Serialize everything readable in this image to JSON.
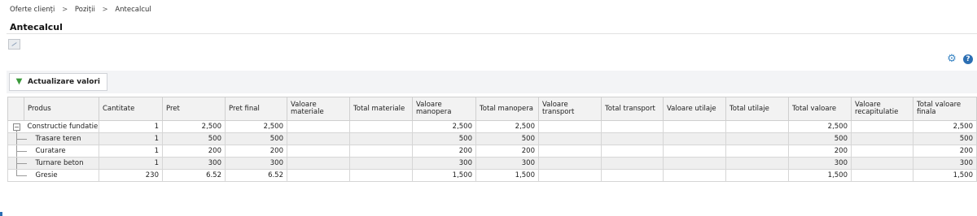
{
  "breadcrumb": [
    "Oferte clienți",
    "Poziții",
    "Antecalcul"
  ],
  "breadcrumb_separator": ">",
  "page_title": "Antecalcul",
  "icons": {
    "settings": "gear-icon",
    "help": "help-icon",
    "help_glyph": "?",
    "update": "refresh-icon"
  },
  "toolbar": {
    "update_label": "Actualizare valori"
  },
  "table": {
    "columns": [
      "Produs",
      "Cantitate",
      "Pret",
      "Pret final",
      "Valoare materiale",
      "Total materiale",
      "Valoare manopera",
      "Total manopera",
      "Valoare transport",
      "Total transport",
      "Valoare utilaje",
      "Total utilaje",
      "Total valoare",
      "Valoare recapitulatie",
      "Total valoare finala"
    ],
    "rows": [
      {
        "produs": "Constructie fundatie",
        "level": 0,
        "cells": [
          "1",
          "2,500",
          "2,500",
          "",
          "",
          "2,500",
          "2,500",
          "",
          "",
          "",
          "",
          "2,500",
          "",
          "2,500"
        ]
      },
      {
        "produs": "Trasare teren",
        "level": 1,
        "cells": [
          "1",
          "500",
          "500",
          "",
          "",
          "500",
          "500",
          "",
          "",
          "",
          "",
          "500",
          "",
          "500"
        ]
      },
      {
        "produs": "Curatare",
        "level": 1,
        "cells": [
          "1",
          "200",
          "200",
          "",
          "",
          "200",
          "200",
          "",
          "",
          "",
          "",
          "200",
          "",
          "200"
        ]
      },
      {
        "produs": "Turnare beton",
        "level": 1,
        "cells": [
          "1",
          "300",
          "300",
          "",
          "",
          "300",
          "300",
          "",
          "",
          "",
          "",
          "300",
          "",
          "300"
        ]
      },
      {
        "produs": "Gresie",
        "level": 1,
        "cells": [
          "230",
          "6.52",
          "6.52",
          "",
          "",
          "1,500",
          "1,500",
          "",
          "",
          "",
          "",
          "1,500",
          "",
          "1,500"
        ]
      }
    ]
  }
}
